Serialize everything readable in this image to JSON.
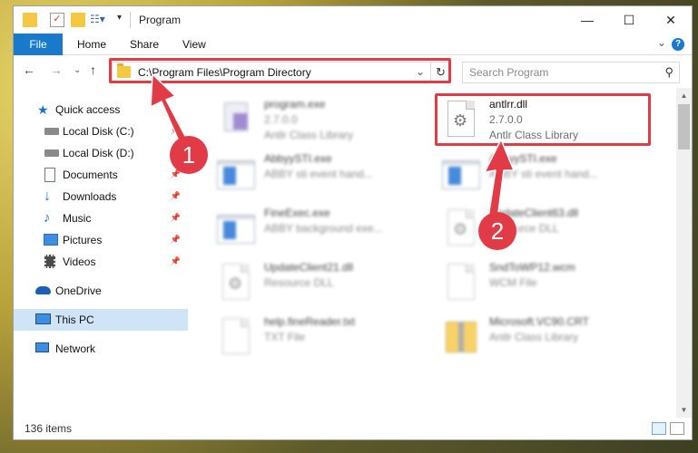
{
  "window": {
    "title": "Program",
    "controls": [
      "minimize",
      "maximize",
      "close"
    ]
  },
  "ribbon": {
    "tabs": [
      "File",
      "Home",
      "Share",
      "View"
    ]
  },
  "address": {
    "path": "C:\\Program Files\\Program Directory"
  },
  "search": {
    "placeholder": "Search Program"
  },
  "sidebar": {
    "items": [
      {
        "label": "Quick access",
        "icon": "star-icon"
      },
      {
        "label": "Local Disk (C:)",
        "icon": "drive-icon",
        "pinned": true
      },
      {
        "label": "Local Disk (D:)",
        "icon": "drive-icon",
        "pinned": true
      },
      {
        "label": "Documents",
        "icon": "documents-icon",
        "pinned": true
      },
      {
        "label": "Downloads",
        "icon": "downloads-icon",
        "pinned": true
      },
      {
        "label": "Music",
        "icon": "music-icon",
        "pinned": true
      },
      {
        "label": "Pictures",
        "icon": "pictures-icon",
        "pinned": true
      },
      {
        "label": "Videos",
        "icon": "videos-icon",
        "pinned": true
      },
      {
        "label": "OneDrive",
        "icon": "onedrive-icon"
      },
      {
        "label": "This PC",
        "icon": "this-pc-icon",
        "selected": true
      },
      {
        "label": "Network",
        "icon": "network-icon"
      }
    ]
  },
  "files": [
    {
      "name": "program.exe",
      "line2": "2.7.0.0",
      "line3": "Antlr Class Library",
      "icon": "program-exe-icon"
    },
    {
      "name": "antlrr.dll",
      "line2": "2.7.0.0",
      "line3": "Antlr Class Library",
      "icon": "dll-gear-icon"
    },
    {
      "name": "AbbyySTI.exe",
      "line2": "ABBY sti event hand...",
      "line3": "",
      "icon": "app-window-icon"
    },
    {
      "name": "AbbyySTI.exe",
      "line2": "ABBY sti event hand...",
      "line3": "",
      "icon": "app-window-icon"
    },
    {
      "name": "FineExec.exe",
      "line2": "ABBY background exe...",
      "line3": "",
      "icon": "app-window-icon"
    },
    {
      "name": "UpdateClient63.dll",
      "line2": "Resource DLL",
      "line3": "",
      "icon": "dll-gear-icon"
    },
    {
      "name": "UpdateClient21.dll",
      "line2": "Resource DLL",
      "line3": "",
      "icon": "dll-gear-icon"
    },
    {
      "name": "SndToWP12.wcm",
      "line2": "WCM File",
      "line3": "",
      "icon": "blank-file-icon"
    },
    {
      "name": "help.fineReader.txt",
      "line2": "TXT File",
      "line3": "",
      "icon": "blank-file-icon"
    },
    {
      "name": "Microsoft.VC90.CRT",
      "line2": "Antlr Class Library",
      "line3": "",
      "icon": "zip-folder-icon"
    }
  ],
  "status": {
    "item_count": "136 items"
  },
  "annotations": {
    "callout1": "1",
    "callout2": "2"
  },
  "colors": {
    "accent": "#1979ca",
    "highlight_box": "#e03b47",
    "selected_nav": "#cfe5f7"
  }
}
